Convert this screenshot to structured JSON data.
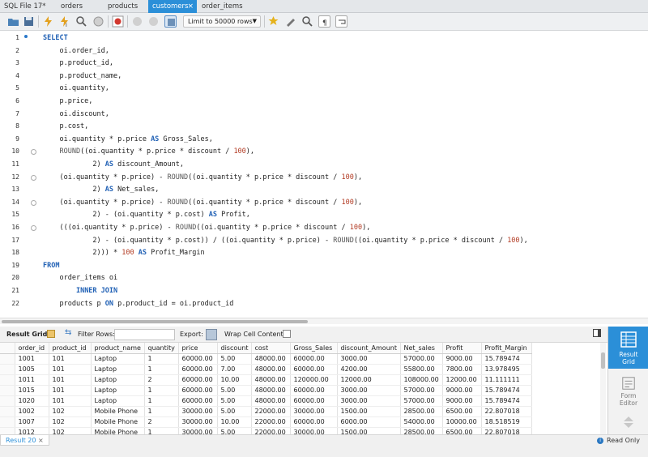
{
  "tabs": [
    {
      "label": "SQL File 17*"
    },
    {
      "label": "orders"
    },
    {
      "label": "products"
    },
    {
      "label": "customers",
      "close": "×"
    },
    {
      "label": "order_items"
    }
  ],
  "toolbar": {
    "limit_label": "Limit to 50000 rows",
    "limit_caret": "▼",
    "icons": [
      "open-folder-icon",
      "save-icon",
      "execute-icon",
      "execute-statement-icon",
      "explain-icon",
      "stop-icon",
      "stop-on-error-icon",
      "commit-icon",
      "rollback-icon",
      "autocommit-icon",
      "beautify-icon",
      "find-icon",
      "invisible-chars-icon",
      "wrap-icon"
    ]
  },
  "editor": {
    "lines": [
      {
        "n": "1",
        "seg": [
          [
            "k",
            "SELECT"
          ]
        ]
      },
      {
        "n": "2",
        "seg": [
          [
            "t",
            "    oi.order_id,"
          ]
        ]
      },
      {
        "n": "3",
        "seg": [
          [
            "t",
            "    p.product_id,"
          ]
        ]
      },
      {
        "n": "4",
        "seg": [
          [
            "t",
            "    p.product_name,"
          ]
        ]
      },
      {
        "n": "5",
        "seg": [
          [
            "t",
            "    oi.quantity,"
          ]
        ]
      },
      {
        "n": "6",
        "seg": [
          [
            "t",
            "    p.price,"
          ]
        ]
      },
      {
        "n": "7",
        "seg": [
          [
            "t",
            "    oi.discount,"
          ]
        ]
      },
      {
        "n": "8",
        "seg": [
          [
            "t",
            "    p.cost,"
          ]
        ]
      },
      {
        "n": "9",
        "seg": [
          [
            "t",
            "    oi.quantity * p.price "
          ],
          [
            "k",
            "AS"
          ],
          [
            "t",
            " Gross_Sales,"
          ]
        ]
      },
      {
        "n": "10",
        "seg": [
          [
            "t",
            "    "
          ],
          [
            "f",
            "ROUND"
          ],
          [
            "t",
            "((oi.quantity * p.price * discount / "
          ],
          [
            "n",
            "100"
          ],
          [
            "t",
            "),"
          ]
        ]
      },
      {
        "n": "11",
        "seg": [
          [
            "t",
            "            2) "
          ],
          [
            "k",
            "AS"
          ],
          [
            "t",
            " discount_Amount,"
          ]
        ]
      },
      {
        "n": "12",
        "seg": [
          [
            "t",
            "    (oi.quantity * p.price) - "
          ],
          [
            "f",
            "ROUND"
          ],
          [
            "t",
            "((oi.quantity * p.price * discount / "
          ],
          [
            "n",
            "100"
          ],
          [
            "t",
            "),"
          ]
        ]
      },
      {
        "n": "13",
        "seg": [
          [
            "t",
            "            2) "
          ],
          [
            "k",
            "AS"
          ],
          [
            "t",
            " Net_sales,"
          ]
        ]
      },
      {
        "n": "14",
        "seg": [
          [
            "t",
            "    (oi.quantity * p.price) - "
          ],
          [
            "f",
            "ROUND"
          ],
          [
            "t",
            "((oi.quantity * p.price * discount / "
          ],
          [
            "n",
            "100"
          ],
          [
            "t",
            "),"
          ]
        ]
      },
      {
        "n": "15",
        "seg": [
          [
            "t",
            "            2) - (oi.quantity * p.cost) "
          ],
          [
            "k",
            "AS"
          ],
          [
            "t",
            " Profit,"
          ]
        ]
      },
      {
        "n": "16",
        "seg": [
          [
            "t",
            "    (((oi.quantity * p.price) - "
          ],
          [
            "f",
            "ROUND"
          ],
          [
            "t",
            "((oi.quantity * p.price * discount / "
          ],
          [
            "n",
            "100"
          ],
          [
            "t",
            "),"
          ]
        ]
      },
      {
        "n": "17",
        "seg": [
          [
            "t",
            "            2) - (oi.quantity * p.cost)) / ((oi.quantity * p.price) - "
          ],
          [
            "f",
            "ROUND"
          ],
          [
            "t",
            "((oi.quantity * p.price * discount / "
          ],
          [
            "n",
            "100"
          ],
          [
            "t",
            "),"
          ]
        ]
      },
      {
        "n": "18",
        "seg": [
          [
            "t",
            "            2))) * "
          ],
          [
            "n",
            "100"
          ],
          [
            "t",
            " "
          ],
          [
            "k",
            "AS"
          ],
          [
            "t",
            " Profit_Margin"
          ]
        ]
      },
      {
        "n": "19",
        "seg": [
          [
            "k",
            "FROM"
          ]
        ]
      },
      {
        "n": "20",
        "seg": [
          [
            "t",
            "    order_items oi"
          ]
        ]
      },
      {
        "n": "21",
        "seg": [
          [
            "t",
            "        "
          ],
          [
            "k",
            "INNER JOIN"
          ]
        ]
      },
      {
        "n": "22",
        "seg": [
          [
            "t",
            "    products p "
          ],
          [
            "k",
            "ON"
          ],
          [
            "t",
            " p.product_id = oi.product_id"
          ]
        ]
      }
    ]
  },
  "result_toolbar": {
    "result_grid": "Result Grid",
    "filter_rows": "Filter Rows:",
    "export": "Export:",
    "wrap": "Wrap Cell Content:"
  },
  "grid": {
    "columns": [
      "order_id",
      "product_id",
      "product_name",
      "quantity",
      "price",
      "discount",
      "cost",
      "Gross_Sales",
      "discount_Amount",
      "Net_sales",
      "Profit",
      "Profit_Margin"
    ],
    "rows": [
      [
        "1001",
        "101",
        "Laptop",
        "1",
        "60000.00",
        "5.00",
        "48000.00",
        "60000.00",
        "3000.00",
        "57000.00",
        "9000.00",
        "15.789474"
      ],
      [
        "1005",
        "101",
        "Laptop",
        "1",
        "60000.00",
        "7.00",
        "48000.00",
        "60000.00",
        "4200.00",
        "55800.00",
        "7800.00",
        "13.978495"
      ],
      [
        "1011",
        "101",
        "Laptop",
        "2",
        "60000.00",
        "10.00",
        "48000.00",
        "120000.00",
        "12000.00",
        "108000.00",
        "12000.00",
        "11.111111"
      ],
      [
        "1015",
        "101",
        "Laptop",
        "1",
        "60000.00",
        "5.00",
        "48000.00",
        "60000.00",
        "3000.00",
        "57000.00",
        "9000.00",
        "15.789474"
      ],
      [
        "1020",
        "101",
        "Laptop",
        "1",
        "60000.00",
        "5.00",
        "48000.00",
        "60000.00",
        "3000.00",
        "57000.00",
        "9000.00",
        "15.789474"
      ],
      [
        "1002",
        "102",
        "Mobile Phone",
        "1",
        "30000.00",
        "5.00",
        "22000.00",
        "30000.00",
        "1500.00",
        "28500.00",
        "6500.00",
        "22.807018"
      ],
      [
        "1007",
        "102",
        "Mobile Phone",
        "2",
        "30000.00",
        "10.00",
        "22000.00",
        "60000.00",
        "6000.00",
        "54000.00",
        "10000.00",
        "18.518519"
      ],
      [
        "1012",
        "102",
        "Mobile Phone",
        "1",
        "30000.00",
        "5.00",
        "22000.00",
        "30000.00",
        "1500.00",
        "28500.00",
        "6500.00",
        "22.807018"
      ]
    ]
  },
  "side": {
    "result_grid": "Result Grid",
    "form_editor": "Form Editor"
  },
  "status": {
    "result_tab": "Result 20",
    "read_only": "Read Only",
    "close": "×"
  }
}
